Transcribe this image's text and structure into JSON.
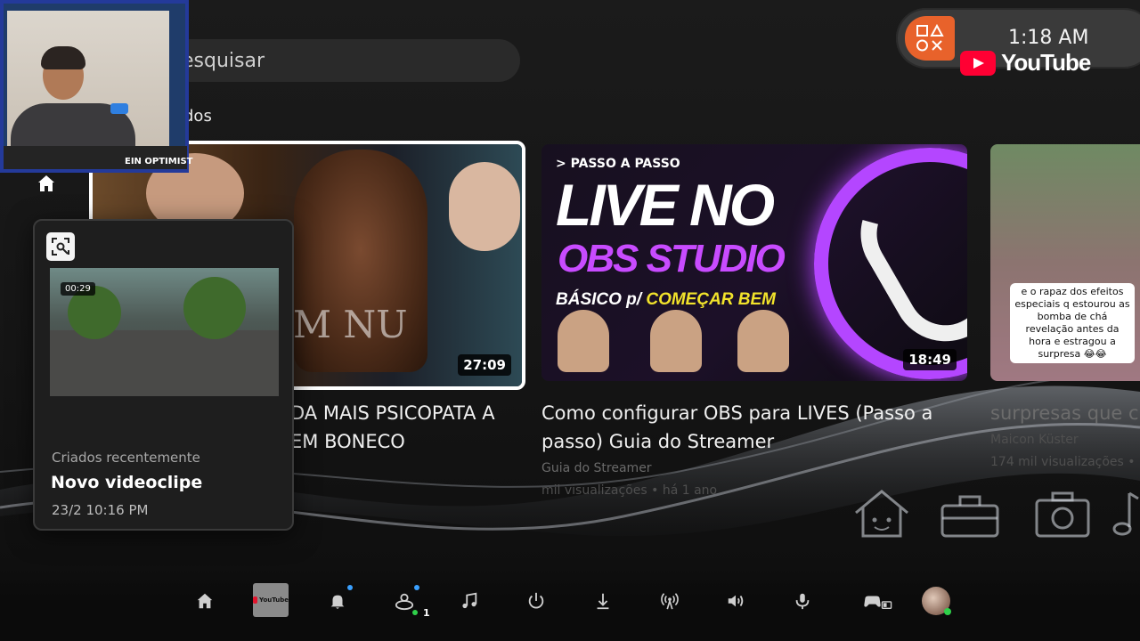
{
  "search": {
    "placeholder_text": "esquisar"
  },
  "section": {
    "label": "dos"
  },
  "status": {
    "clock": "1:18 AM",
    "app_name": "YouTube"
  },
  "webcam": {
    "label": "EIN OPTIMIST"
  },
  "cards": [
    {
      "title": "DA MAIS PSICOPATA A EM BONECO",
      "duration": "27:09",
      "art_text": "M NU"
    },
    {
      "title": "Como configurar OBS para LIVES (Passo a passo) Guia do Streamer",
      "duration": "18:49",
      "channel": "Guia do Streamer",
      "stats": "mil visualizações • há 1 ano",
      "art_tag": "PASSO A PASSO",
      "art_line1": "LIVE NO",
      "art_line2": "OBS STUDIO",
      "art_line3a": "BÁSICO p/ ",
      "art_line3b": "COMEÇAR BEM"
    },
    {
      "title": "surpresas que c",
      "channel": "Maicon Küster",
      "stats": "174 mil visualizações •",
      "caption": "e o rapaz dos efeitos especiais q estourou as bomba de chá revelação antes da hora e estragou a surpresa 😂😂"
    }
  ],
  "capture_popup": {
    "duration": "00:29",
    "subtitle": "Criados recentemente",
    "title": "Novo videoclipe",
    "date": "23/2  10:16 PM"
  },
  "control_center": {
    "youtube_tile_label": "YouTube",
    "party_count": "1",
    "items": [
      "home-icon",
      "youtube-tile",
      "bell-icon",
      "party-icon",
      "music-icon",
      "power-icon",
      "download-icon",
      "broadcast-icon",
      "volume-icon",
      "mic-icon",
      "controller-icon",
      "avatar"
    ],
    "colors": {
      "notification_dot": "#3aa0ff",
      "online_dot": "#2fd04a",
      "accent": "#e8622b",
      "youtube_red": "#ff0033"
    }
  }
}
